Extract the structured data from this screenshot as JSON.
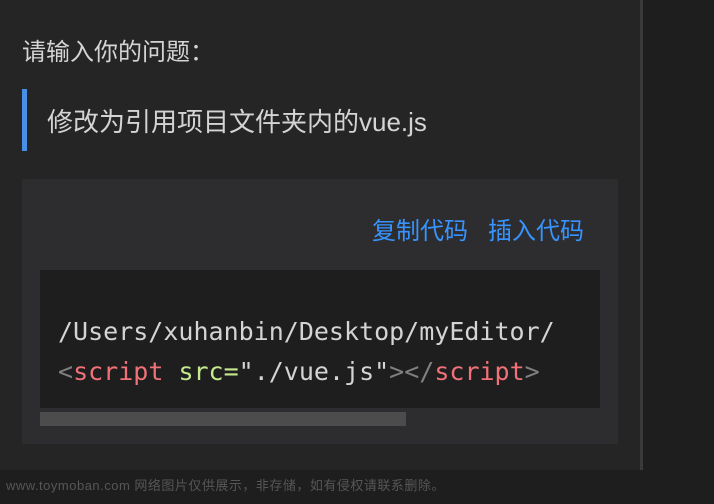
{
  "prompt": {
    "label": "请输入你的问题："
  },
  "quote": {
    "text": "修改为引用项目文件夹内的vue.js"
  },
  "code": {
    "toolbar": {
      "copy": "复制代码",
      "insert": "插入代码"
    },
    "line1": "/Users/xuhanbin/Desktop/myEditor/",
    "line2": {
      "lt1": "<",
      "tag1": "script",
      "sp": " ",
      "attr": "src=",
      "str": "\"./vue.js\"",
      "gt1": ">",
      "lt2": "</",
      "tag2": "script",
      "gt2": ">"
    }
  },
  "watermark": "www.toymoban.com 网络图片仅供展示，非存储，如有侵权请联系删除。"
}
